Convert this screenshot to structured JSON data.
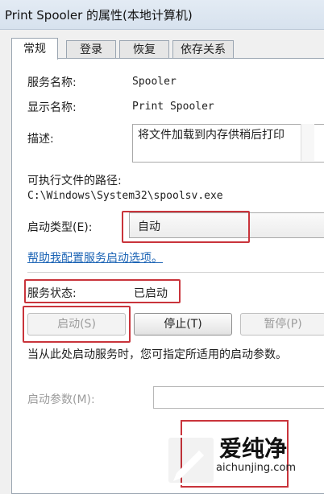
{
  "window": {
    "title": "Print Spooler 的属性(本地计算机)"
  },
  "tabs": [
    "常规",
    "登录",
    "恢复",
    "依存关系"
  ],
  "general": {
    "service_name_label": "服务名称:",
    "service_name_value": "Spooler",
    "display_name_label": "显示名称:",
    "display_name_value": "Print Spooler",
    "description_label": "描述:",
    "description_value": "将文件加载到内存供稍后打印",
    "exec_path_label": "可执行文件的路径:",
    "exec_path_value": "C:\\Windows\\System32\\spoolsv.exe",
    "startup_type_label": "启动类型(E):",
    "startup_type_value": "自动",
    "help_link": "帮助我配置服务启动选项。",
    "status_label": "服务状态:",
    "status_value": "已启动",
    "buttons": {
      "start": "启动(S)",
      "stop": "停止(T)",
      "pause": "暂停(P)"
    },
    "hint": "当从此处启动服务时，您可指定所适用的启动参数。",
    "start_params_label": "启动参数(M):",
    "start_params_value": ""
  },
  "watermark": {
    "brand": "爱纯净",
    "url": "aichunjing.com"
  },
  "colors": {
    "highlight": "#c9343b",
    "link": "#1c64b5"
  }
}
